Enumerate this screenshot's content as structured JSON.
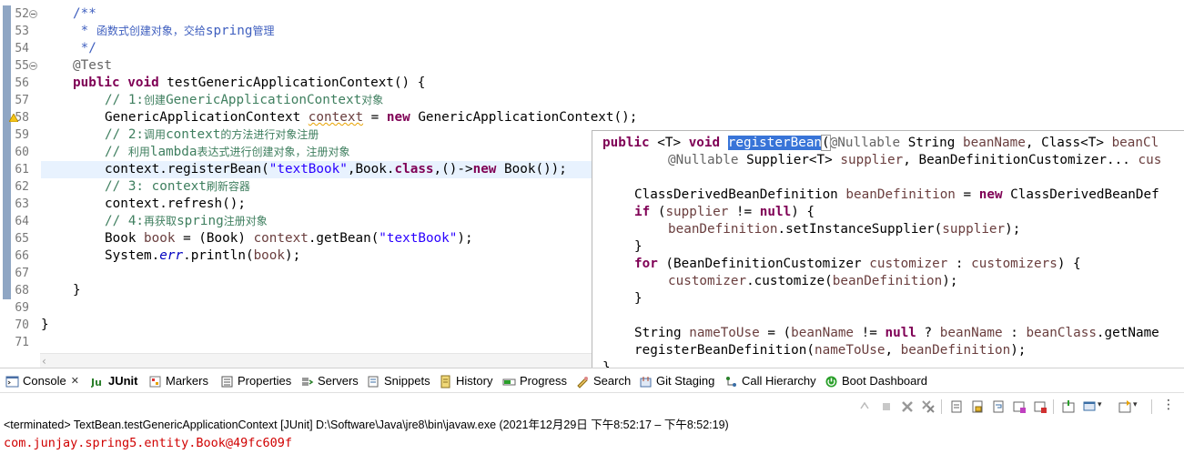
{
  "editor": {
    "line_numbers": [
      "52",
      "53",
      "54",
      "55",
      "56",
      "57",
      "58",
      "59",
      "60",
      "61",
      "62",
      "63",
      "64",
      "65",
      "66",
      "67",
      "68",
      "69",
      "70",
      "71"
    ],
    "code": {
      "l52": "/**",
      "l53_star": " * ",
      "l53_text": "函数式创建对象，交给",
      "l53_mid": "spring",
      "l53_end": "管理",
      "l54": " */",
      "l55": "@Test",
      "l56_kw": "public void",
      "l56_rest": " testGenericApplicationContext() {",
      "l57_a": "// 1:",
      "l57_b": "创建",
      "l57_c": "GenericApplicationContext",
      "l57_d": "对象",
      "l58_a": "GenericApplicationContext ",
      "l58_var": "context",
      "l58_b": " = ",
      "l58_kw": "new",
      "l58_c": " GenericApplicationContext();",
      "l59_a": "// 2:",
      "l59_b": "调用",
      "l59_c": "context",
      "l59_d": "的方法进行对象注册",
      "l60_a": "// ",
      "l60_b": "利用",
      "l60_c": "lambda",
      "l60_d": "表达式进行创建对象，注册对象",
      "l61_a": "context.registerBean(",
      "l61_str": "\"textBook\"",
      "l61_b": ",Book.",
      "l61_kw": "class",
      "l61_c": ",()->",
      "l61_kw2": "new",
      "l61_d": " Book());",
      "l62_a": "// 3: context",
      "l62_b": "刷新容器",
      "l63": "context.refresh();",
      "l64_a": "// 4:",
      "l64_b": "再获取",
      "l64_c": "spring",
      "l64_d": "注册对象",
      "l65_a": "Book ",
      "l65_var": "book",
      "l65_b": " = (Book) ",
      "l65_var2": "context",
      "l65_c": ".getBean(",
      "l65_str": "\"textBook\"",
      "l65_d": ");",
      "l66_a": "System.",
      "l66_fld": "err",
      "l66_b": ".println(",
      "l66_var": "book",
      "l66_c": ");",
      "l68": "}",
      "l70": "}"
    }
  },
  "popup": {
    "p1_kw1": "public",
    "p1_a": " <T> ",
    "p1_kw2": "void",
    "p1_sel": "registerBean",
    "p1_br": "(",
    "p1_b": "@Nullable",
    "p1_c": " String ",
    "p1_var": "beanName",
    "p1_d": ", Class<T> ",
    "p1_var2": "beanCl",
    "p2_a": "@Nullable",
    "p2_b": " Supplier<T> ",
    "p2_var": "supplier",
    "p2_c": ", BeanDefinitionCustomizer... ",
    "p2_var2": "cus",
    "p4_a": "ClassDerivedBeanDefinition ",
    "p4_var": "beanDefinition",
    "p4_b": " = ",
    "p4_kw": "new",
    "p4_c": " ClassDerivedBeanDef",
    "p5_kw": "if",
    "p5_a": " (",
    "p5_var": "supplier",
    "p5_b": " != ",
    "p5_kw2": "null",
    "p5_c": ") {",
    "p6_var": "beanDefinition",
    "p6_a": ".setInstanceSupplier(",
    "p6_var2": "supplier",
    "p6_b": ");",
    "p7": "}",
    "p8_kw": "for",
    "p8_a": " (BeanDefinitionCustomizer ",
    "p8_var": "customizer",
    "p8_b": " : ",
    "p8_var2": "customizers",
    "p8_c": ") {",
    "p9_var": "customizer",
    "p9_a": ".customize(",
    "p9_var2": "beanDefinition",
    "p9_b": ");",
    "p10": "}",
    "p12_a": "String ",
    "p12_var": "nameToUse",
    "p12_b": " = (",
    "p12_var2": "beanName",
    "p12_c": " != ",
    "p12_kw": "null",
    "p12_d": " ? ",
    "p12_var3": "beanName",
    "p12_e": " : ",
    "p12_var4": "beanClass",
    "p12_f": ".getName",
    "p13_a": "registerBeanDefinition(",
    "p13_var": "nameToUse",
    "p13_b": ", ",
    "p13_var2": "beanDefinition",
    "p13_c": ");",
    "p14": "}"
  },
  "tabs": [
    {
      "label": "Console",
      "icon": "console-icon"
    },
    {
      "label": "JUnit",
      "icon": "junit-icon"
    },
    {
      "label": "Markers",
      "icon": "markers-icon"
    },
    {
      "label": "Properties",
      "icon": "properties-icon"
    },
    {
      "label": "Servers",
      "icon": "servers-icon"
    },
    {
      "label": "Snippets",
      "icon": "snippets-icon"
    },
    {
      "label": "History",
      "icon": "history-icon"
    },
    {
      "label": "Progress",
      "icon": "progress-icon"
    },
    {
      "label": "Search",
      "icon": "search-icon"
    },
    {
      "label": "Git Staging",
      "icon": "git-staging-icon"
    },
    {
      "label": "Call Hierarchy",
      "icon": "call-hierarchy-icon"
    },
    {
      "label": "Boot Dashboard",
      "icon": "boot-dashboard-icon"
    }
  ],
  "console": {
    "header": "<terminated> TextBean.testGenericApplicationContext [JUnit] D:\\Software\\Java\\jre8\\bin\\javaw.exe  (2021年12月29日 下午8:52:17 – 下午8:52:19)",
    "output": "com.junjay.spring5.entity.Book@49fc609f"
  },
  "colors": {
    "keyword": "#7f0055",
    "comment": "#3f7f5f",
    "javadoc": "#3f5fbf",
    "string": "#2a00ff",
    "selection": "#3874d8",
    "error_output": "#d00000"
  }
}
